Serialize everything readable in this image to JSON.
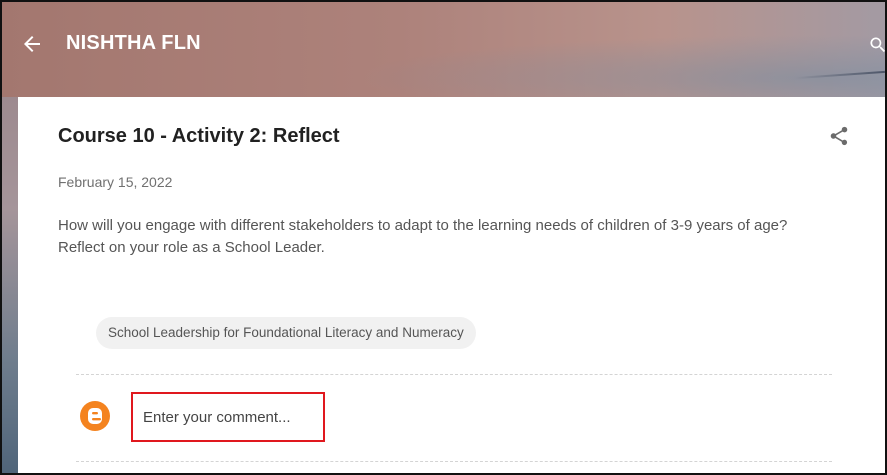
{
  "header": {
    "blog_title": "NISHTHA FLN",
    "back_icon": "arrow-left-icon",
    "search_icon": "search-icon"
  },
  "post": {
    "title": "Course 10 - Activity 2: Reflect",
    "date": "February 15, 2022",
    "body_line_1": "How will you engage with different stakeholders to adapt to the learning needs of children of 3-9 years of age?",
    "body_line_2": "Reflect on your role as a School Leader.",
    "share_icon": "share-icon"
  },
  "labels": [
    "School Leadership for Foundational Literacy and Numeracy"
  ],
  "comments": {
    "avatar_icon": "blogger-icon",
    "input_placeholder": "Enter your comment..."
  },
  "colors": {
    "highlight": "#e0181e",
    "blogger_orange": "#f4831f"
  }
}
